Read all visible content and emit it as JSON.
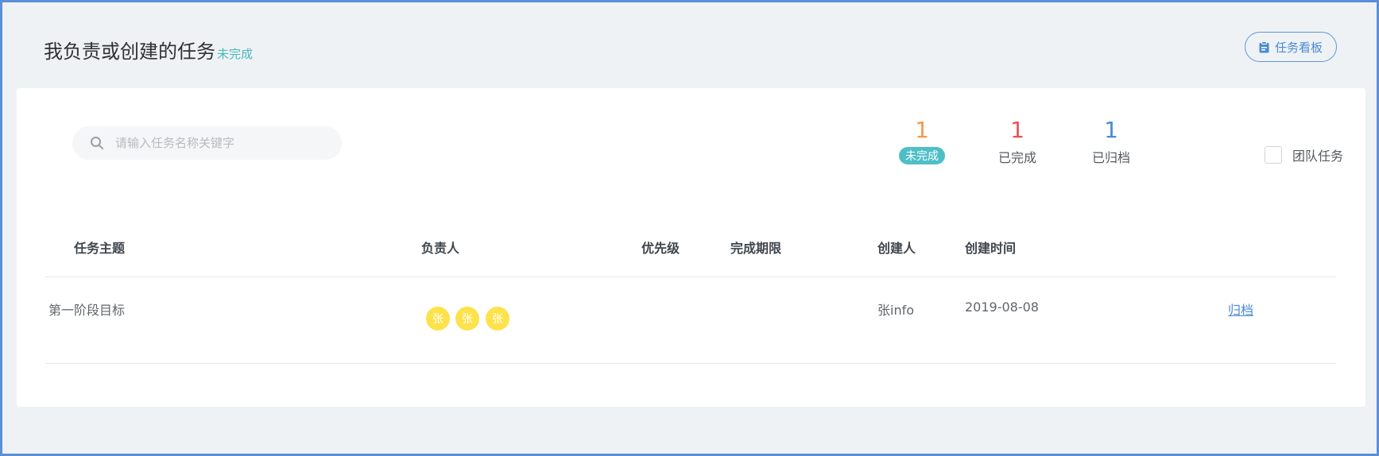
{
  "header": {
    "title": "我负责或创建的任务",
    "status": "未完成",
    "kanban_button": "任务看板",
    "kanban_icon": "clipboard-icon"
  },
  "search": {
    "placeholder": "请输入任务名称关键字",
    "value": "",
    "icon": "search-icon"
  },
  "stats": [
    {
      "count": "1",
      "label": "未完成",
      "color": "#f39a4b",
      "active": true
    },
    {
      "count": "1",
      "label": "已完成",
      "color": "#e8525a",
      "active": false
    },
    {
      "count": "1",
      "label": "已归档",
      "color": "#4a8ad5",
      "active": false
    }
  ],
  "team_filter": {
    "label": "团队任务",
    "checked": false
  },
  "table": {
    "columns": [
      "任务主题",
      "负责人",
      "优先级",
      "完成期限",
      "创建人",
      "创建时间"
    ],
    "rows": [
      {
        "subject": "第一阶段目标",
        "assignees": [
          "张",
          "张",
          "张"
        ],
        "priority": "",
        "deadline": "",
        "creator": "张info",
        "created_at": "2019-08-08",
        "action": "归档"
      }
    ]
  },
  "colors": {
    "accent": "#4a8ad5",
    "teal": "#4ebfc6",
    "avatar": "#fde24a",
    "frame_border": "#5b8fd6"
  }
}
